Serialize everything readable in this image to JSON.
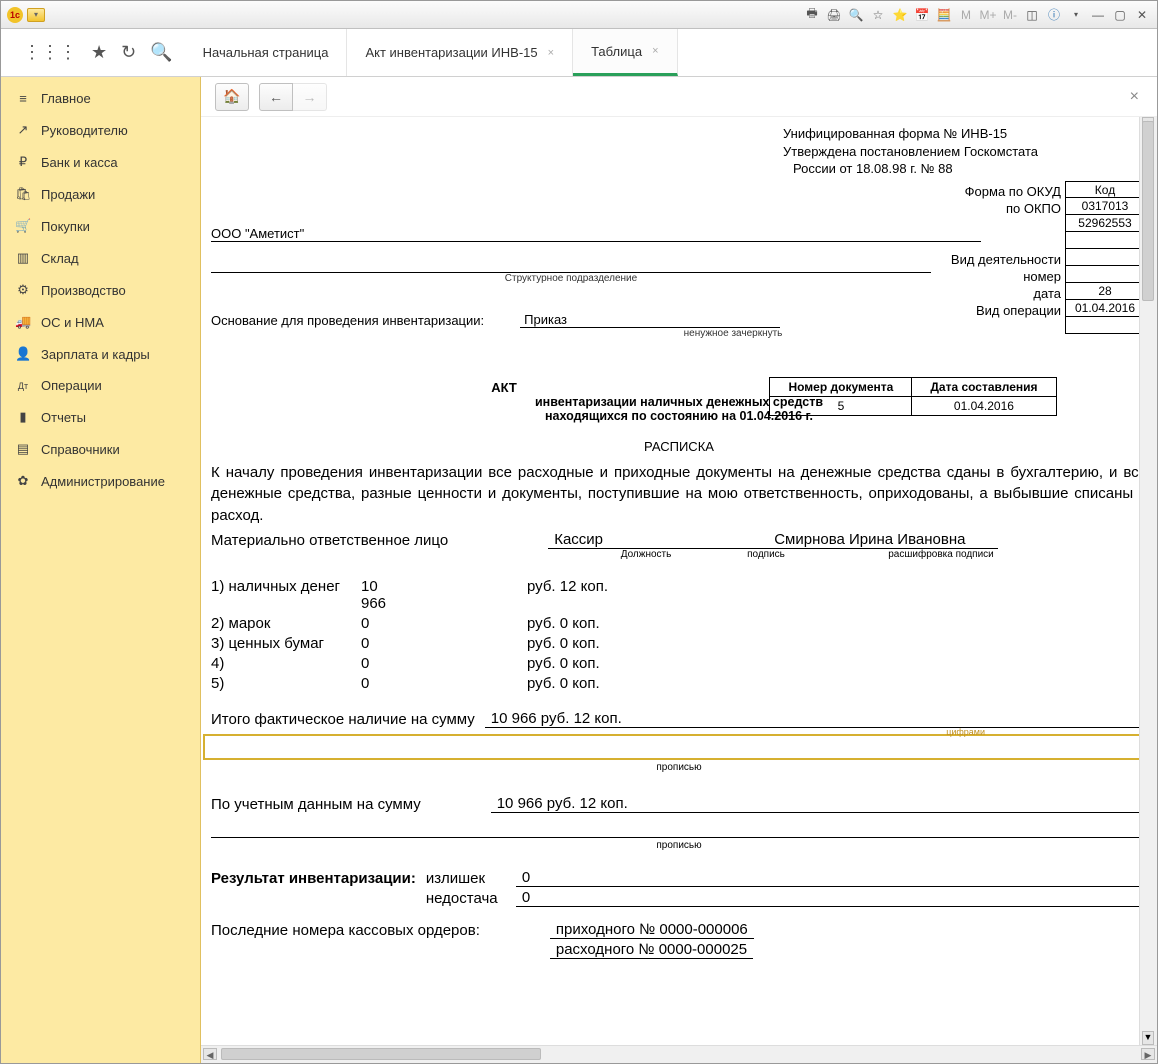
{
  "titlebar": {
    "icons_right": [
      "print",
      "printer",
      "preview",
      "star",
      "fav",
      "cal",
      "grid",
      "M",
      "M+",
      "M-",
      "panels",
      "info"
    ]
  },
  "tabs": [
    {
      "label": "Начальная страница",
      "closeable": false,
      "active": false
    },
    {
      "label": "Акт инвентаризации ИНВ-15",
      "closeable": true,
      "active": false
    },
    {
      "label": "Таблица",
      "closeable": true,
      "active": true
    }
  ],
  "sidebar": {
    "items": [
      {
        "icon": "≡",
        "label": "Главное"
      },
      {
        "icon": "↗",
        "label": "Руководителю"
      },
      {
        "icon": "₽",
        "label": "Банк и касса"
      },
      {
        "icon": "🛍",
        "label": "Продажи"
      },
      {
        "icon": "🛒",
        "label": "Покупки"
      },
      {
        "icon": "▥",
        "label": "Склад"
      },
      {
        "icon": "⚙",
        "label": "Производство"
      },
      {
        "icon": "🚚",
        "label": "ОС и НМА"
      },
      {
        "icon": "👤",
        "label": "Зарплата и кадры"
      },
      {
        "icon": "Дт",
        "label": "Операции"
      },
      {
        "icon": "▮",
        "label": "Отчеты"
      },
      {
        "icon": "▤",
        "label": "Справочники"
      },
      {
        "icon": "✿",
        "label": "Администрирование"
      }
    ]
  },
  "doc": {
    "form_title_l1": "Унифицированная форма №  ИНВ-15",
    "form_title_l2": "Утверждена постановлением Госкомстата",
    "form_title_l3": "России от 18.08.98 г. № 88",
    "code_hdr": "Код",
    "okud_lbl": "Форма по ОКУД",
    "okud_val": "0317013",
    "okpo_lbl": "по ОКПО",
    "okpo_val": "52962553",
    "activity_lbl": "Вид деятельности",
    "number_lbl": "номер",
    "number_val": "28",
    "date_lbl": "дата",
    "date_val": "01.04.2016",
    "optype_lbl": "Вид операции",
    "org": "ООО \"Аметист\"",
    "division_lbl": "Структурное подразделение",
    "basis_lbl": "Основание для проведения инвентаризации:",
    "basis_val": "Приказ",
    "basis_hint": "ненужное зачеркнуть",
    "docnum_hdr": "Номер документа",
    "docdate_hdr": "Дата составления",
    "docnum_val": "5",
    "docdate_val": "01.04.2016",
    "akt": "АКТ",
    "akt_l1": "инвентаризации наличных денежных средств",
    "akt_l2": "находящихся по состоянию на 01.04.2016 г.",
    "raspiska": "РАСПИСКА",
    "body": "К началу проведения инвентаризации все расходные и приходные документы на денежные средства сданы в бухгалтерию, и все денежные средства, разные ценности и документы, поступившие на мою ответственность, оприходованы, а выбывшие списаны в расход.",
    "resp_lbl": "Материально ответственное лицо",
    "position": "Кассир",
    "fio": "Смирнова Ирина Ивановна",
    "sub_position": "Должность",
    "sub_sign": "подпись",
    "sub_fio": "расшифровка подписи",
    "rows": [
      {
        "n": "1) наличных денег",
        "v": "10 966",
        "rk": "руб. 12 коп."
      },
      {
        "n": "2) марок",
        "v": "0",
        "rk": "руб. 0 коп."
      },
      {
        "n": "3) ценных бумаг",
        "v": "0",
        "rk": "руб. 0 коп."
      },
      {
        "n": "4)",
        "v": "0",
        "rk": "руб. 0 коп."
      },
      {
        "n": "5)",
        "v": "0",
        "rk": "руб. 0 коп."
      }
    ],
    "total_lbl": "Итого  фактическое  наличие  на  сумму",
    "total_val": "10 966 руб. 12 коп.",
    "words_hint": "цифрами",
    "prop": "прописью",
    "acct_lbl": "По  учетным данным  на  сумму",
    "acct_val": "10 966 руб. 12 коп.",
    "result_lbl": "Результат инвентаризации:",
    "surplus_lbl": "излишек",
    "surplus_val": "0",
    "short_lbl": "недостача",
    "short_val": "0",
    "orders_lbl": "Последние номера кассовых ордеров:",
    "in_lbl": "приходного № 0000-000006",
    "out_lbl": "расходного № 0000-000025"
  }
}
